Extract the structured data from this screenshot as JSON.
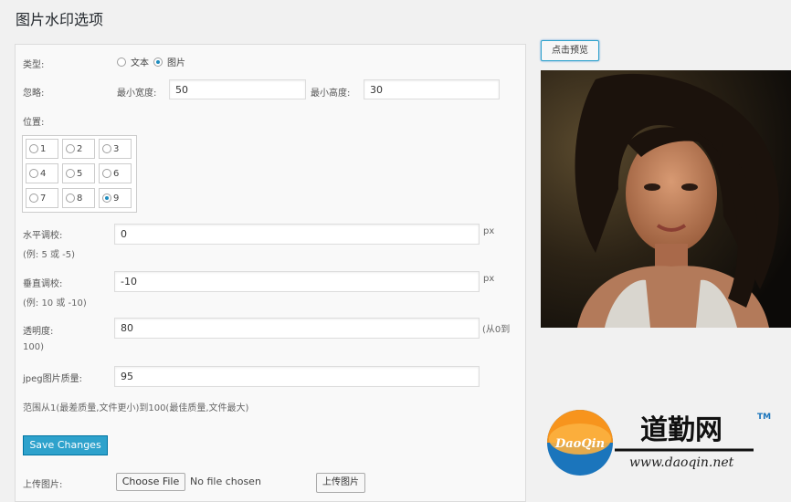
{
  "page": {
    "title": "图片水印选项"
  },
  "form": {
    "type_label": "类型:",
    "type_options": [
      "文本",
      "图片"
    ],
    "type_selected": "图片",
    "ignore_label": "忽略:",
    "min_width_label": "最小宽度:",
    "min_width_value": "50",
    "min_height_label": "最小高度:",
    "min_height_value": "30",
    "position_label": "位置:",
    "positions": [
      "1",
      "2",
      "3",
      "4",
      "5",
      "6",
      "7",
      "8",
      "9"
    ],
    "position_selected": "9",
    "h_adjust_label": "水平调校:",
    "h_adjust_hint": "(例: 5 或 -5)",
    "h_adjust_value": "0",
    "h_adjust_unit": "px",
    "v_adjust_label": "垂直调校:",
    "v_adjust_hint": "(例: 10 或 -10)",
    "v_adjust_value": "-10",
    "v_adjust_unit": "px",
    "opacity_label": "透明度:",
    "opacity_value": "80",
    "opacity_hint_a": "(从0到",
    "opacity_hint_b": "100)",
    "jpeg_label": "jpeg图片质量:",
    "jpeg_value": "95",
    "jpeg_hint": "范围从1(最差质量,文件更小)到100(最佳质量,文件最大)",
    "save_label": "Save Changes",
    "upload_label": "上传图片:",
    "choose_file_label": "Choose File",
    "no_file_label": "No file chosen",
    "upload_button_label": "上传图片"
  },
  "preview": {
    "button_label": "点击预览"
  },
  "watermark": {
    "badge_text": "DaoQin",
    "brand_text": "道勤网",
    "tm": "TM",
    "url": "www.daoqin.net"
  },
  "colors": {
    "accent": "#2ea2cc",
    "logo_orange": "#f7941d",
    "logo_blue": "#1b75bc"
  }
}
